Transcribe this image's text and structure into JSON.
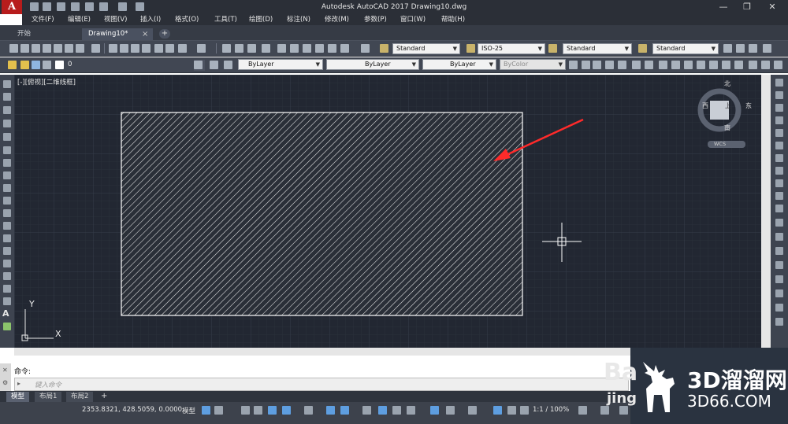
{
  "window": {
    "title": "Autodesk AutoCAD 2017    Drawing10.dwg",
    "logo": "A",
    "minimize": "—",
    "restore": "❐",
    "close": "✕"
  },
  "menu": [
    "文件(F)",
    "编辑(E)",
    "视图(V)",
    "插入(I)",
    "格式(O)",
    "工具(T)",
    "绘图(D)",
    "标注(N)",
    "修改(M)",
    "参数(P)",
    "窗口(W)",
    "帮助(H)"
  ],
  "tabs": {
    "start": "开始",
    "drawing": "Drawing10*",
    "close_icon": "×",
    "add": "+"
  },
  "toolbar1": {
    "text_style": "Standard",
    "dim_style": "ISO-25",
    "table_style": "Standard",
    "mleader_style": "Standard"
  },
  "toolbar2": {
    "layer": "0",
    "color": "ByLayer",
    "linetype": "ByLayer",
    "lineweight": "ByLayer",
    "plotstyle": "ByColor"
  },
  "viewport": {
    "label": "[-][俯视][二维线框]",
    "viewcube": {
      "north": "北",
      "south": "南",
      "east": "东",
      "west": "西",
      "face": "上",
      "wcs": "WCS"
    },
    "ucs_x": "X",
    "ucs_y": "Y"
  },
  "command": {
    "history": "命令:",
    "placeholder": "键入命令",
    "prompt_icon": "▸"
  },
  "layout_tabs": [
    "模型",
    "布局1",
    "布局2"
  ],
  "layout_add": "+",
  "status": {
    "coords": "2353.8321, 428.5059, 0.0000",
    "model": "模型",
    "scale": "1:1 / 100%"
  },
  "watermark": {
    "brand": "3D溜溜网",
    "url": "3D66.COM",
    "ghost": "Ba",
    "ghost2": "jing"
  },
  "colors": {
    "viewport_bg": "#222732",
    "hatch": "#e8e8e8",
    "arrow": "#ff2a2a"
  }
}
